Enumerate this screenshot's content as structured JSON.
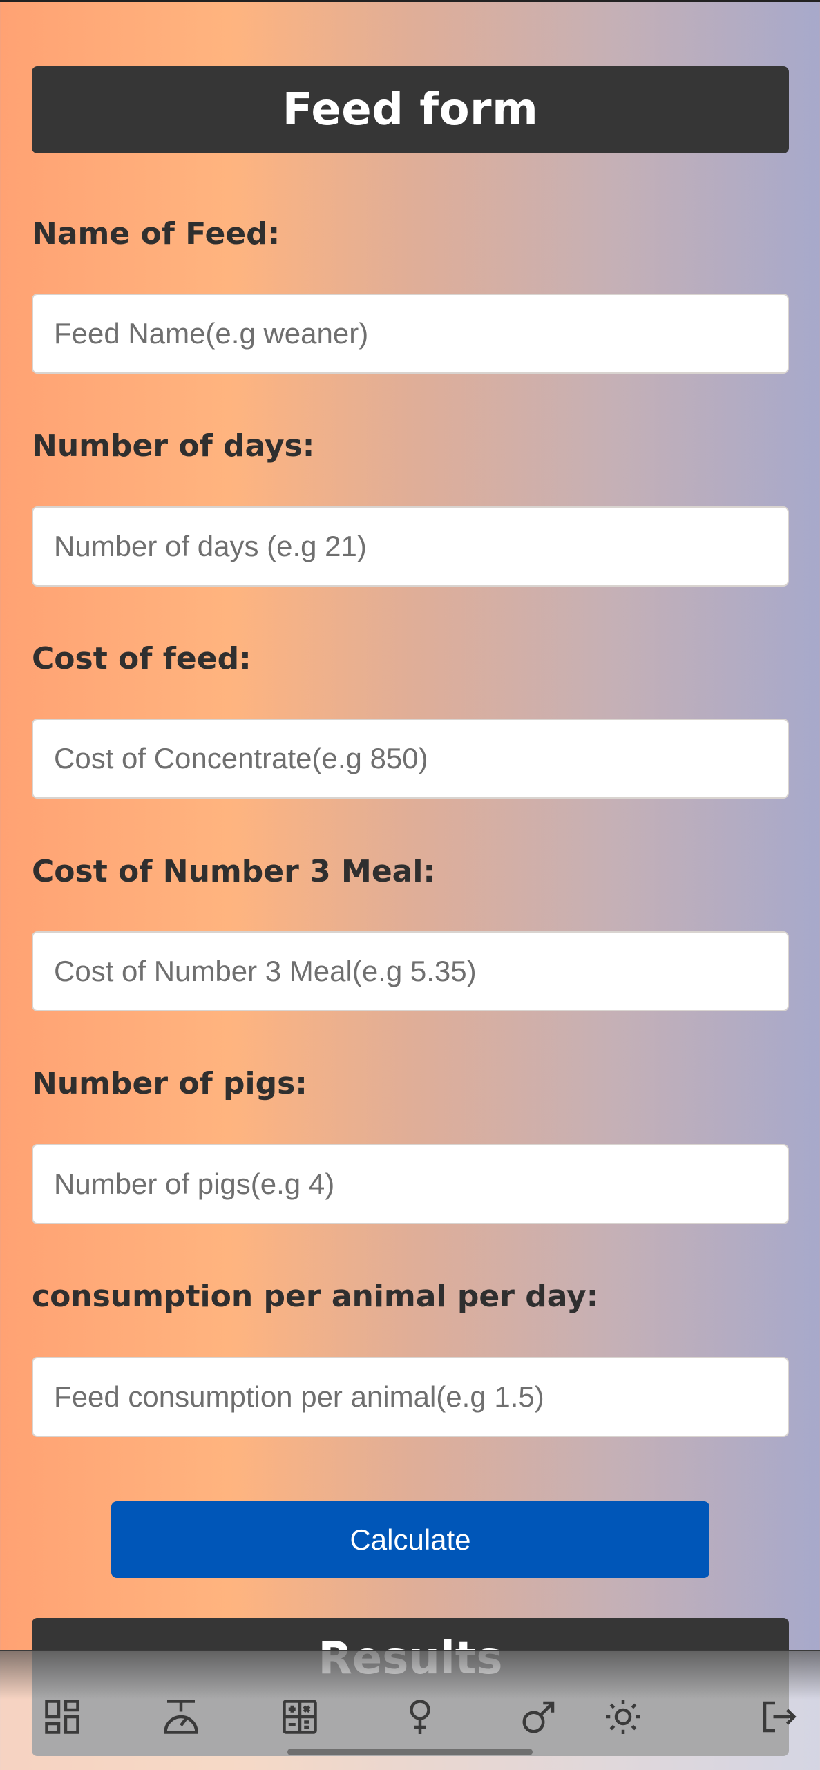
{
  "header": {
    "title": "Feed form"
  },
  "form": {
    "feed_name": {
      "label": "Name of Feed:",
      "placeholder": "Feed Name(e.g weaner)",
      "value": ""
    },
    "days": {
      "label": "Number of days:",
      "placeholder": "Number of days (e.g 21)",
      "value": ""
    },
    "feed_cost": {
      "label": "Cost of feed:",
      "placeholder": "Cost of Concentrate(e.g 850)",
      "value": ""
    },
    "meal_cost": {
      "label": "Cost of Number 3 Meal:",
      "placeholder": "Cost of Number 3 Meal(e.g 5.35)",
      "value": ""
    },
    "pigs": {
      "label": "Number of pigs:",
      "placeholder": "Number of pigs(e.g 4)",
      "value": ""
    },
    "consumption": {
      "label": "consumption per animal per day:",
      "placeholder": "Feed consumption per animal(e.g 1.5)",
      "value": ""
    }
  },
  "calculate_label": "Calculate",
  "results": {
    "title": "Results"
  },
  "nav": {
    "items": [
      {
        "icon": "dashboard-icon"
      },
      {
        "icon": "scale-icon"
      },
      {
        "icon": "calculator-icon"
      },
      {
        "icon": "female-icon"
      },
      {
        "icon": "male-icon"
      },
      {
        "icon": "sun-icon"
      },
      {
        "icon": "logout-icon"
      }
    ]
  },
  "colors": {
    "header_bg": "#363636",
    "button_bg": "#0056b8",
    "label_text": "#2f2f2f",
    "icon": "#3a3a3a"
  }
}
